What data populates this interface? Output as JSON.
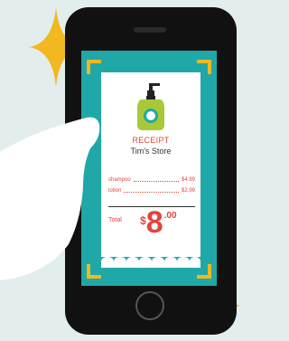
{
  "receipt": {
    "title": "RECEIPT",
    "store": "Tim's Store",
    "items": [
      {
        "name": "shampoo",
        "price": "$4.99"
      },
      {
        "name": "lotion",
        "price": "$2.99"
      }
    ],
    "total_label": "Total",
    "total_currency": "$",
    "total_dollars": "8",
    "total_cents": ".00"
  },
  "colors": {
    "background": "#e2eeee",
    "phone": "#111111",
    "screen": "#1fa8a7",
    "accent_yellow": "#f2b820",
    "receipt_red": "#e2453b",
    "bottle_green": "#a8c83a"
  },
  "icons": [
    "sparkle-icon",
    "lotion-bottle-icon",
    "phone-home-button"
  ]
}
